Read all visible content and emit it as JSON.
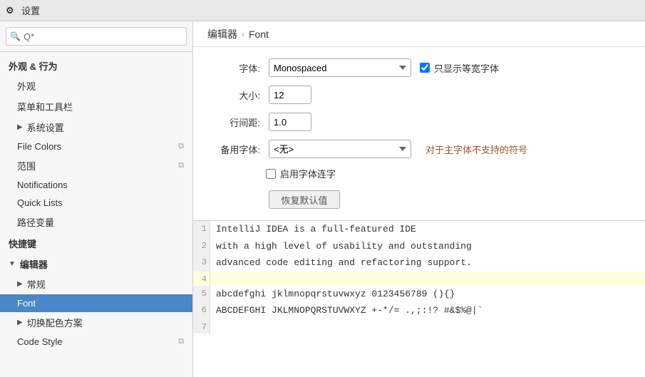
{
  "titleBar": {
    "icon": "⚙",
    "title": "设置"
  },
  "sidebar": {
    "searchPlaceholder": "Q*",
    "sections": [
      {
        "type": "section",
        "label": "外观 & 行为"
      },
      {
        "type": "item",
        "label": "外观",
        "indent": 1
      },
      {
        "type": "item",
        "label": "菜单和工具栏",
        "indent": 1
      },
      {
        "type": "item",
        "label": "系统设置",
        "indent": 1,
        "hasChevron": true,
        "collapsed": true
      },
      {
        "type": "item",
        "label": "File Colors",
        "indent": 1,
        "hasCopyIcon": true
      },
      {
        "type": "item",
        "label": "范围",
        "indent": 1,
        "hasCopyIcon": true
      },
      {
        "type": "item",
        "label": "Notifications",
        "indent": 1
      },
      {
        "type": "item",
        "label": "Quick Lists",
        "indent": 1
      },
      {
        "type": "item",
        "label": "路径变量",
        "indent": 1
      },
      {
        "type": "section",
        "label": "快捷键"
      },
      {
        "type": "section",
        "label": "编辑器",
        "hasChevron": true,
        "expanded": true
      },
      {
        "type": "item",
        "label": "常规",
        "indent": 1,
        "hasChevron": true,
        "collapsed": true
      },
      {
        "type": "item",
        "label": "Font",
        "indent": 1,
        "active": true
      },
      {
        "type": "item",
        "label": "切换配色方案",
        "indent": 1,
        "hasChevron": true,
        "collapsed": true
      },
      {
        "type": "item",
        "label": "Code Style",
        "indent": 1,
        "hasCopyIcon": true
      }
    ]
  },
  "breadcrumb": {
    "parent": "编辑器",
    "separator": "›",
    "current": "Font"
  },
  "form": {
    "fontLabel": "字体:",
    "fontValue": "Monospaced",
    "monospacedCheckboxLabel": "只显示等宽字体",
    "monospacedChecked": true,
    "sizeLabel": "大小:",
    "sizeValue": "12",
    "lineSpacingLabel": "行间距:",
    "lineSpacingValue": "1.0",
    "fallbackFontLabel": "备用字体:",
    "fallbackFontValue": "<无>",
    "fallbackHint": "对于主字体不支持的符号",
    "ligatureLabel": "启用字体连字",
    "ligatureChecked": false,
    "resetButton": "恢复默认值"
  },
  "preview": {
    "lines": [
      {
        "num": "1",
        "text": "IntelliJ IDEA is a full-featured IDE",
        "highlight": false
      },
      {
        "num": "2",
        "text": "with a high level of usability and outstanding",
        "highlight": false
      },
      {
        "num": "3",
        "text": "advanced code editing and refactoring support.",
        "highlight": false
      },
      {
        "num": "4",
        "text": "",
        "highlight": true
      },
      {
        "num": "5",
        "text": "abcdefghi jklmnopqrstuvwxyz 0123456789 (){}",
        "highlight": false
      },
      {
        "num": "6",
        "text": "ABCDEFGHI JKLMNOPQRSTUVWXYZ +-*/= .,;:!? #&$%@|`",
        "highlight": false
      },
      {
        "num": "7",
        "text": "",
        "highlight": false
      }
    ]
  }
}
